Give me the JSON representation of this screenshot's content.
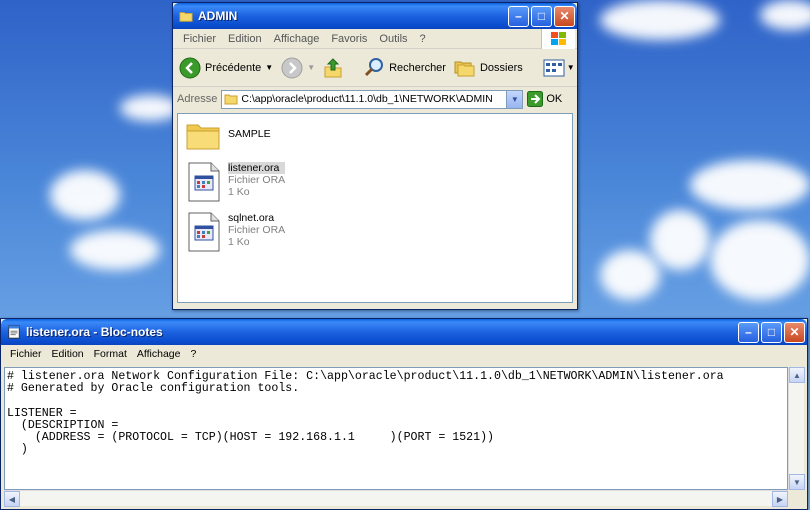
{
  "explorer": {
    "title": "ADMIN",
    "menu": [
      "Fichier",
      "Edition",
      "Affichage",
      "Favoris",
      "Outils",
      "?"
    ],
    "toolbar": {
      "back_label": "Précédente",
      "search_label": "Rechercher",
      "folders_label": "Dossiers"
    },
    "address": {
      "label": "Adresse",
      "path": "C:\\app\\oracle\\product\\11.1.0\\db_1\\NETWORK\\ADMIN",
      "go_label": "OK"
    },
    "files": [
      {
        "name": "SAMPLE",
        "type": "",
        "size": ""
      },
      {
        "name": "listener.ora",
        "type": "Fichier ORA",
        "size": "1 Ko"
      },
      {
        "name": "sqlnet.ora",
        "type": "Fichier ORA",
        "size": "1 Ko"
      }
    ]
  },
  "notepad": {
    "title": "listener.ora - Bloc-notes",
    "menu": [
      "Fichier",
      "Edition",
      "Format",
      "Affichage",
      "?"
    ],
    "lines": [
      "# listener.ora Network Configuration File: C:\\app\\oracle\\product\\11.1.0\\db_1\\NETWORK\\ADMIN\\listener.ora",
      "# Generated by Oracle configuration tools.",
      "",
      "LISTENER =",
      "  (DESCRIPTION =",
      "    (ADDRESS = (PROTOCOL = TCP)(HOST = 192.168.1.1     )(PORT = 1521))",
      "  )"
    ]
  },
  "colors": {
    "titlebar": "#0b4ed0",
    "close_button": "#c84820",
    "window_face": "#ece9d8",
    "desktop_sky": "#4a86d8"
  }
}
